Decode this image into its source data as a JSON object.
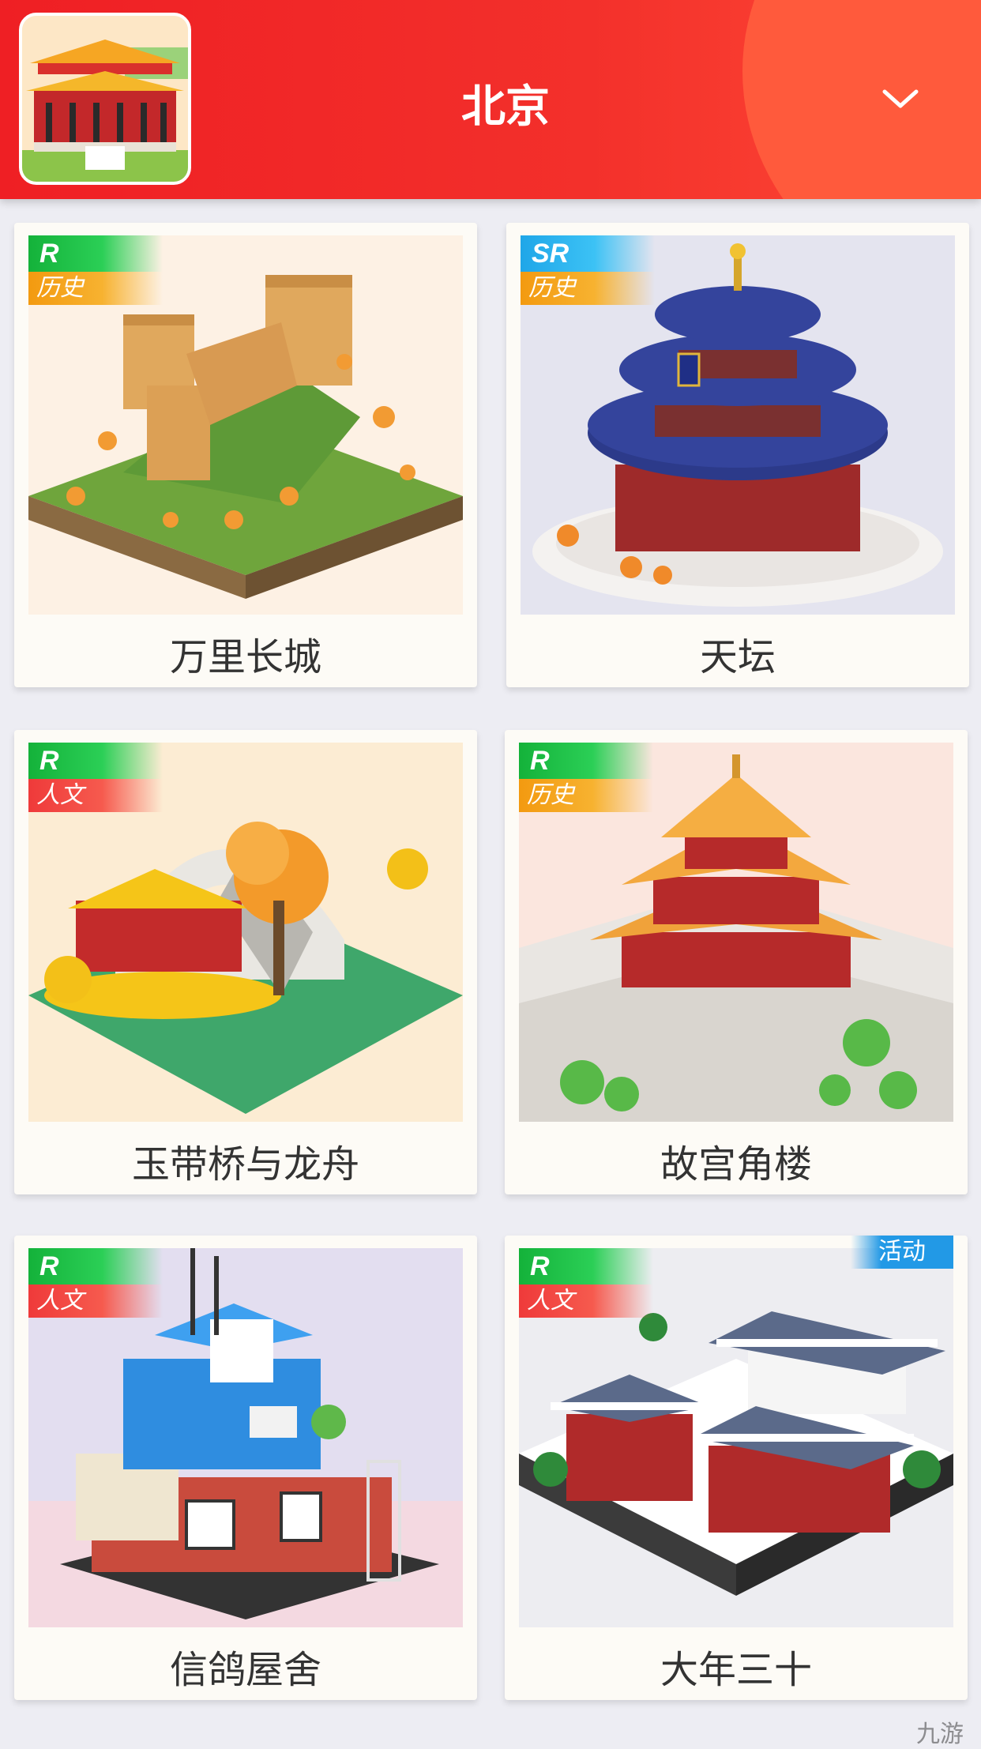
{
  "header": {
    "city": "北京"
  },
  "cards": [
    {
      "name": "万里长城",
      "rarity": "R",
      "category": "历史"
    },
    {
      "name": "天坛",
      "rarity": "SR",
      "category": "历史"
    },
    {
      "name": "玉带桥与龙舟",
      "rarity": "R",
      "category": "人文"
    },
    {
      "name": "故宫角楼",
      "rarity": "R",
      "category": "历史"
    },
    {
      "name": "信鸽屋舍",
      "rarity": "R",
      "category": "人文"
    },
    {
      "name": "大年三十",
      "rarity": "R",
      "category": "人文",
      "badge": "活动"
    }
  ],
  "watermark": "九游"
}
